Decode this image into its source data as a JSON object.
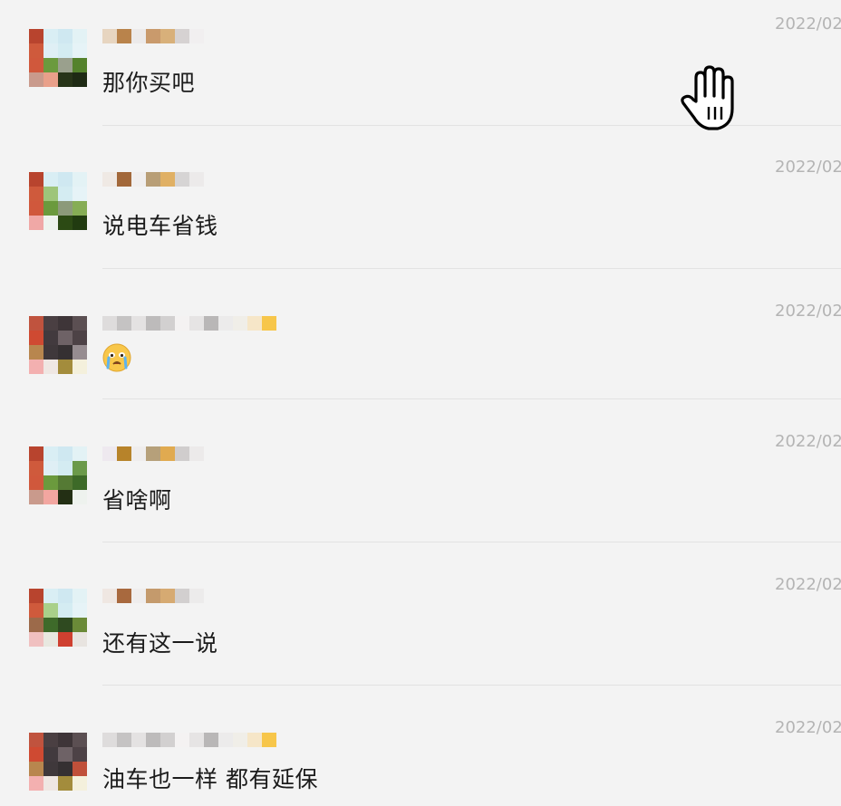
{
  "comments": [
    {
      "text": "那你买吧",
      "time": "2022/02",
      "emoji": null
    },
    {
      "text": "说电车省钱",
      "time": "2022/02",
      "emoji": null
    },
    {
      "text": "",
      "time": "2022/02",
      "emoji": "crying-face-icon"
    },
    {
      "text": "省啥啊",
      "time": "2022/02",
      "emoji": null
    },
    {
      "text": "还有这一说",
      "time": "2022/02",
      "emoji": null
    },
    {
      "text": "油车也一样 都有延保",
      "time": "2022/02",
      "emoji": null
    }
  ],
  "cursor": {
    "icon": "hand-cursor-icon"
  }
}
